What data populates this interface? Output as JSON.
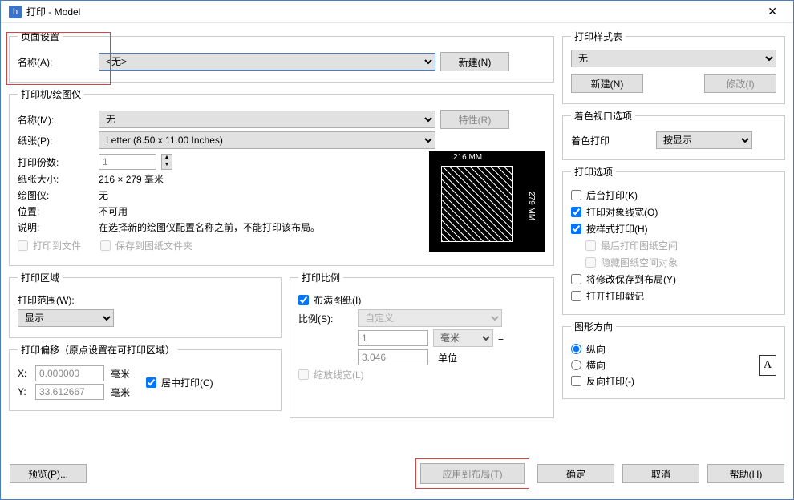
{
  "titlebar": {
    "title": "打印 - Model",
    "close": "✕"
  },
  "page_setup": {
    "legend": "页面设置",
    "name_label": "名称(A):",
    "name_value": "<无>",
    "new_button": "新建(N)"
  },
  "printer": {
    "legend": "打印机/绘图仪",
    "name_label": "名称(M):",
    "name_value": "无",
    "props_button": "特性(R)",
    "paper_label": "纸张(P):",
    "paper_value": "Letter (8.50 x 11.00 Inches)",
    "copies_label": "打印份数:",
    "copies_value": "1",
    "size_label": "纸张大小:",
    "size_value": "216 × 279  毫米",
    "plotter_label": "绘图仪:",
    "plotter_value": "无",
    "location_label": "位置:",
    "location_value": "不可用",
    "desc_label": "说明:",
    "desc_value": "在选择新的绘图仪配置名称之前，不能打印该布局。",
    "print_to_file": "打印到文件",
    "save_to_folder": "保存到图纸文件夹",
    "preview_top": "216 MM",
    "preview_right": "279 MM"
  },
  "print_area": {
    "legend": "打印区域",
    "scope_label": "打印范围(W):",
    "scope_value": "显示"
  },
  "print_offset": {
    "legend": "打印偏移（原点设置在可打印区域）",
    "x_label": "X:",
    "x_value": "0.000000",
    "x_unit": "毫米",
    "y_label": "Y:",
    "y_value": "33.612667",
    "y_unit": "毫米",
    "center": "居中打印(C)"
  },
  "print_scale": {
    "legend": "打印比例",
    "fit": "布满图纸(I)",
    "ratio_label": "比例(S):",
    "ratio_value": "自定义",
    "num_value": "1",
    "unit_value": "毫米",
    "equals": "=",
    "denom_value": "3.046",
    "unit_text": "单位",
    "scale_lw": "缩放线宽(L)"
  },
  "style_table": {
    "legend": "打印样式表",
    "value": "无",
    "new_button": "新建(N)",
    "modify_button": "修改(I)"
  },
  "shade_viewport": {
    "legend": "着色视口选项",
    "shade_label": "着色打印",
    "shade_value": "按显示"
  },
  "plot_options": {
    "legend": "打印选项",
    "bg": "后台打印(K)",
    "lw": "打印对象线宽(O)",
    "style": "按样式打印(H)",
    "last_ps": "最后打印图纸空间",
    "hide_ps": "隐藏图纸空间对象",
    "save_layout": "将修改保存到布局(Y)",
    "stamp": "打开打印戳记"
  },
  "direction": {
    "legend": "图形方向",
    "portrait": "纵向",
    "landscape": "横向",
    "reverse": "反向打印(-)",
    "icon": "A"
  },
  "footer": {
    "preview": "预览(P)...",
    "apply": "应用到布局(T)",
    "ok": "确定",
    "cancel": "取消",
    "help": "帮助(H)"
  }
}
